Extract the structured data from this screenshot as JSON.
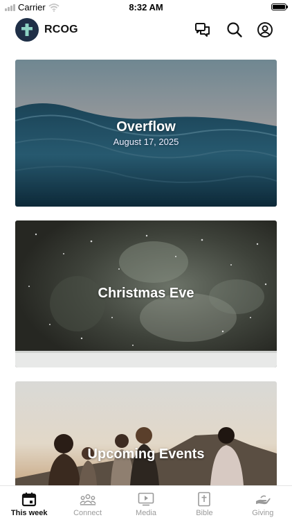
{
  "status_bar": {
    "carrier": "Carrier",
    "time": "8:32 AM",
    "battery_level": 1.0
  },
  "header": {
    "app_name": "RCOG",
    "logo_icon": "cross-icon",
    "actions": [
      {
        "name": "messages",
        "icon": "chat-bubbles-icon"
      },
      {
        "name": "search",
        "icon": "search-icon"
      },
      {
        "name": "account",
        "icon": "user-circle-icon"
      }
    ]
  },
  "cards": [
    {
      "title": "Overflow",
      "subtitle": "August 17, 2025",
      "image": "ocean-waves"
    },
    {
      "title": "Christmas Eve",
      "subtitle": "",
      "image": "snowy-trees"
    },
    {
      "title": "Upcoming Events",
      "subtitle": "",
      "image": "people-at-sunset"
    }
  ],
  "tabs": [
    {
      "label": "This week",
      "icon": "calendar-icon",
      "active": true
    },
    {
      "label": "Connect",
      "icon": "people-group-icon",
      "active": false
    },
    {
      "label": "Media",
      "icon": "play-screen-icon",
      "active": false
    },
    {
      "label": "Bible",
      "icon": "bible-cross-icon",
      "active": false
    },
    {
      "label": "Giving",
      "icon": "giving-hand-icon",
      "active": false
    }
  ],
  "colors": {
    "logo_bg": "#1f2f47",
    "logo_cross": "#8ed3c4",
    "active_tab": "#111111",
    "inactive_tab": "#9a9a9a"
  }
}
